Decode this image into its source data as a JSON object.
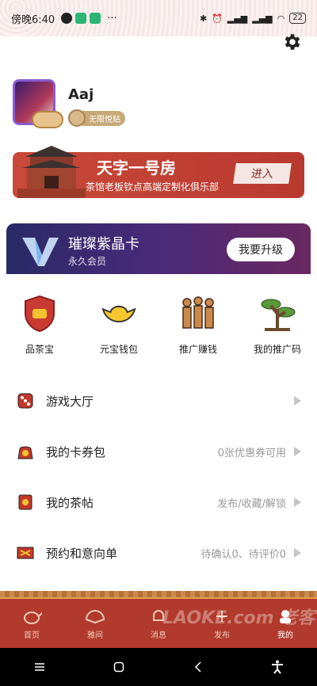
{
  "status_bar": {
    "time": "傍晚6:40",
    "more": "···",
    "battery": "22"
  },
  "profile": {
    "username": "Aaj",
    "badge": "无限悦贴"
  },
  "teahouse_banner": {
    "title": "天字一号房",
    "subtitle": "茶馆老板钦点高端定制化俱乐部",
    "enter_label": "进入"
  },
  "vip_card": {
    "title": "璀璨紫晶卡",
    "subtitle": "永久会员",
    "upgrade_label": "我要升级"
  },
  "shortcuts": [
    {
      "label": "品茶宝",
      "icon": "shield-ingot-icon"
    },
    {
      "label": "元宝钱包",
      "icon": "gold-ingot-icon"
    },
    {
      "label": "推广赚钱",
      "icon": "terracotta-warriors-icon"
    },
    {
      "label": "我的推广码",
      "icon": "pine-tree-icon"
    }
  ],
  "menu": [
    {
      "label": "游戏大厅",
      "info": "",
      "icon": "dice-icon"
    },
    {
      "label": "我的卡券包",
      "info": "0张优惠券可用",
      "icon": "coupon-bag-icon"
    },
    {
      "label": "我的茶帖",
      "info": "发布/收藏/解锁",
      "icon": "tea-post-icon"
    },
    {
      "label": "预约和意向单",
      "info": "待确认0、待评价0",
      "icon": "appointment-icon"
    }
  ],
  "tabs": [
    {
      "label": "首页",
      "icon": "teapot-icon"
    },
    {
      "label": "雅间",
      "icon": "fan-icon"
    },
    {
      "label": "消息",
      "icon": "bell-icon"
    },
    {
      "label": "发布",
      "icon": "publish-icon"
    },
    {
      "label": "我的",
      "icon": "profile-icon"
    }
  ],
  "watermark": "LAOKE.com 老客",
  "colors": {
    "brand_red": "#b13a2c",
    "accent_gold": "#e4a24e",
    "vip_purple": "#4a2a7a"
  }
}
